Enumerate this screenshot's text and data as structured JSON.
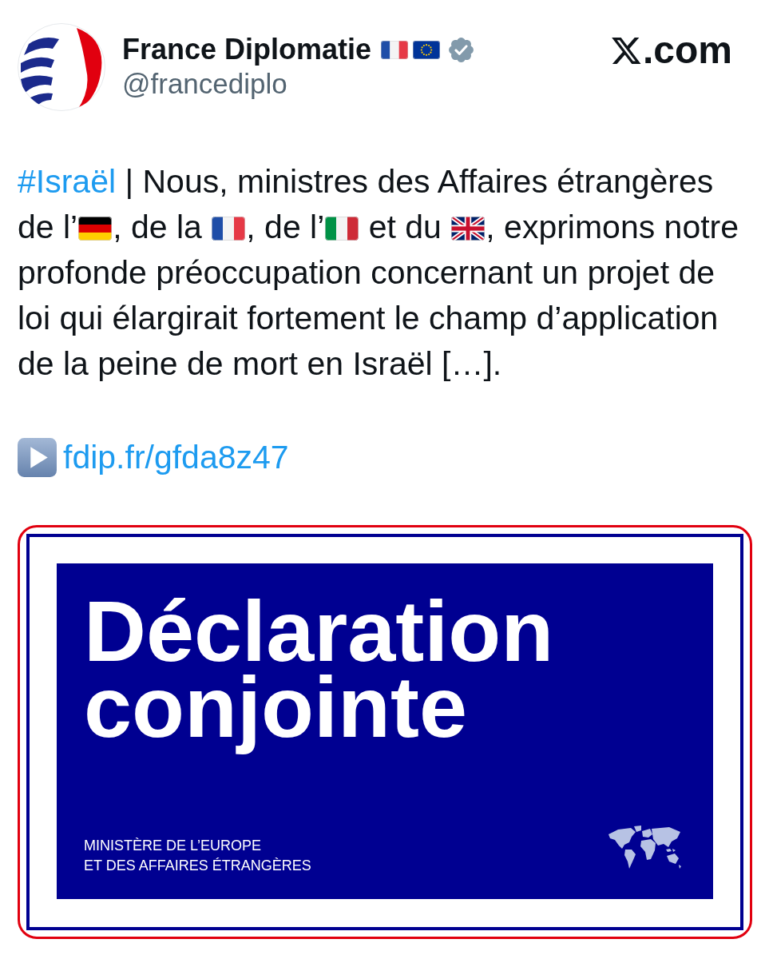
{
  "author": {
    "name": "France Diplomatie",
    "name_emoji": [
      {
        "kind": "flag_fr"
      },
      {
        "kind": "flag_eu"
      }
    ],
    "verified": true,
    "handle": "@francediplo"
  },
  "site": {
    "domain": ".com"
  },
  "tweet": {
    "lines": [
      [
        {
          "kind": "hashtag",
          "text": "#Israël"
        },
        {
          "kind": "text",
          "text": " | Nous, ministres des Affaires étrangères"
        }
      ],
      [
        {
          "kind": "text",
          "text": "de l’"
        },
        {
          "kind": "flag_de"
        },
        {
          "kind": "text",
          "text": ", de la "
        },
        {
          "kind": "flag_fr"
        },
        {
          "kind": "text",
          "text": ", de l’"
        },
        {
          "kind": "flag_it"
        },
        {
          "kind": "text",
          "text": " et du "
        },
        {
          "kind": "flag_gb"
        },
        {
          "kind": "text",
          "text": ", exprimons notre"
        }
      ],
      [
        {
          "kind": "text",
          "text": "profonde préoccupation concernant un projet de"
        }
      ],
      [
        {
          "kind": "text",
          "text": "loi qui élargirait fortement le champ d’application"
        }
      ],
      [
        {
          "kind": "text",
          "text": "de la peine de mort en Israël […]."
        }
      ]
    ],
    "link": "fdip.fr/gfda8z47"
  },
  "media": {
    "title": "Déclaration conjointe",
    "ministry": "MINISTÈRE DE L’EUROPE\nET DES AFFAIRES ÉTRANGÈRES"
  }
}
